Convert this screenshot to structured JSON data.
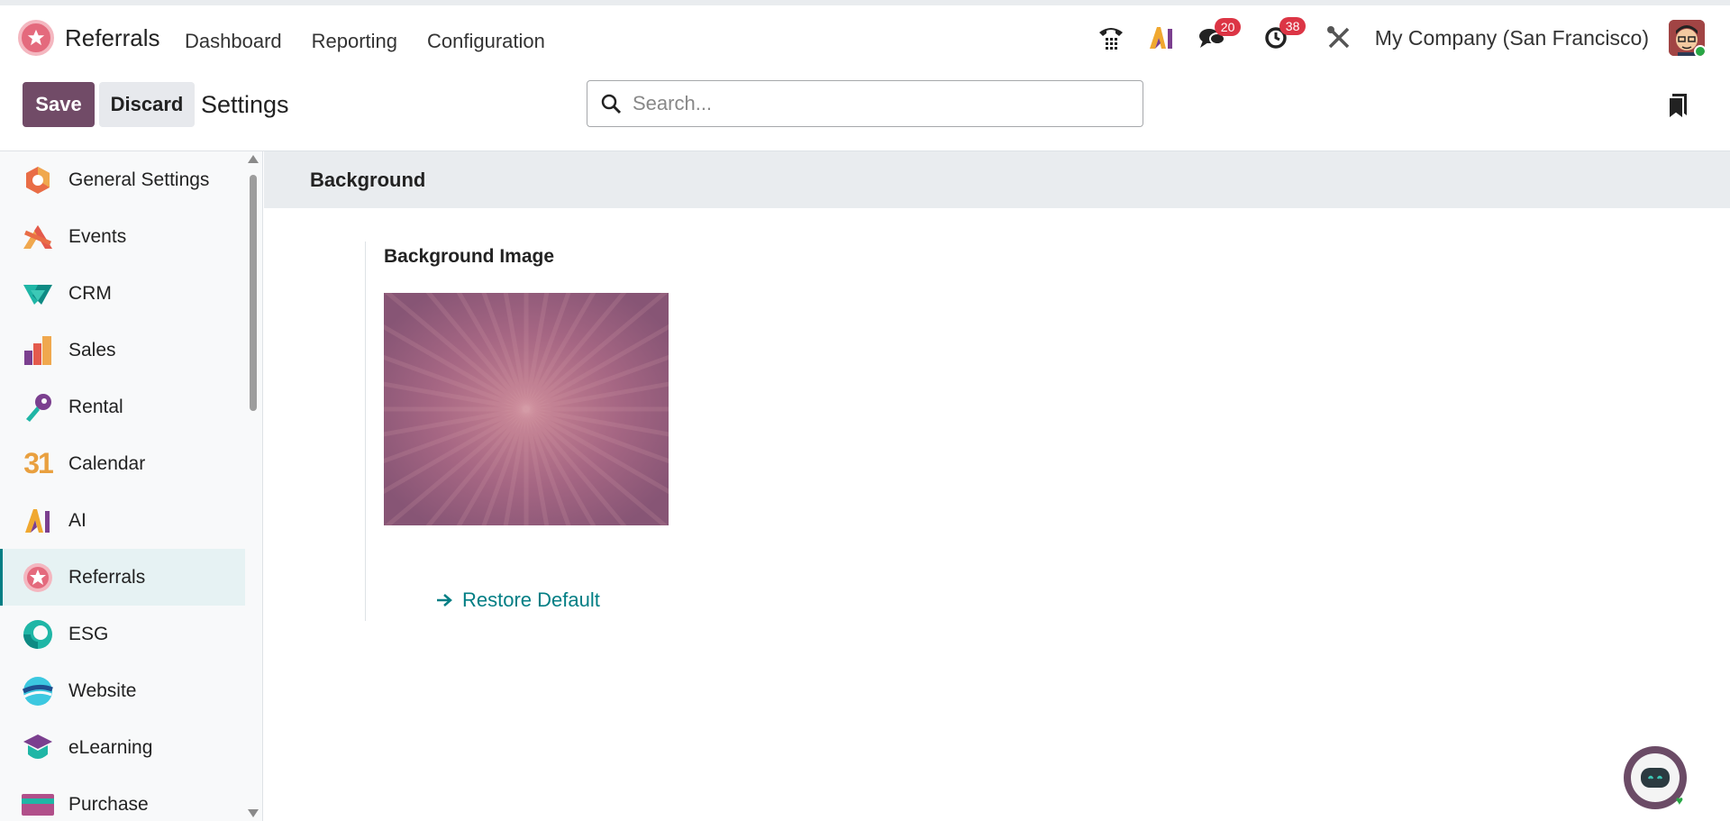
{
  "app": {
    "title": "Referrals"
  },
  "menu": {
    "items": [
      "Dashboard",
      "Reporting",
      "Configuration"
    ]
  },
  "systray": {
    "messages_count": "20",
    "activities_count": "38",
    "company": "My Company (San Francisco)"
  },
  "control": {
    "save_label": "Save",
    "discard_label": "Discard",
    "title": "Settings",
    "search_placeholder": "Search..."
  },
  "sidebar": {
    "items": [
      {
        "label": "General Settings",
        "icon": "general-settings-icon"
      },
      {
        "label": "Events",
        "icon": "events-icon"
      },
      {
        "label": "CRM",
        "icon": "crm-icon"
      },
      {
        "label": "Sales",
        "icon": "sales-icon"
      },
      {
        "label": "Rental",
        "icon": "rental-icon"
      },
      {
        "label": "Calendar",
        "icon": "calendar-icon"
      },
      {
        "label": "AI",
        "icon": "ai-icon"
      },
      {
        "label": "Referrals",
        "icon": "referrals-icon",
        "active": true
      },
      {
        "label": "ESG",
        "icon": "esg-icon"
      },
      {
        "label": "Website",
        "icon": "website-icon"
      },
      {
        "label": "eLearning",
        "icon": "elearning-icon"
      },
      {
        "label": "Purchase",
        "icon": "purchase-icon"
      }
    ],
    "calendar_icon_text": "31"
  },
  "section": {
    "title": "Background",
    "setting_title": "Background Image",
    "restore_label": "Restore Default"
  },
  "colors": {
    "brand": "#714b67",
    "accent": "#017e84",
    "badge": "#dc3545"
  }
}
